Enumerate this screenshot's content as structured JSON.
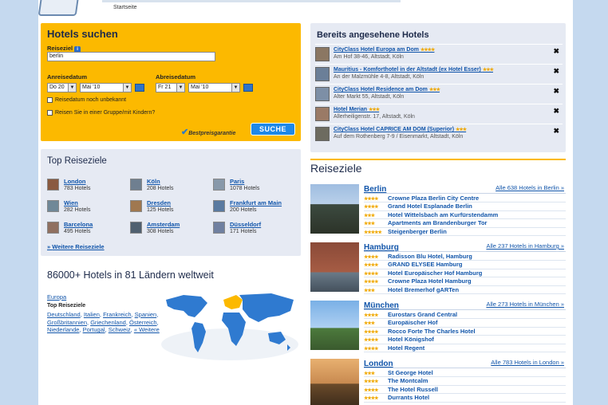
{
  "header": {
    "breadcrumb": "Startseite"
  },
  "search": {
    "title": "Hotels suchen",
    "destination_label": "Reiseziel",
    "destination_value": "berlin",
    "arrival_label": "Anreisedatum",
    "departure_label": "Abreisedatum",
    "arrival_day": "Do 20",
    "arrival_month": "Mai '10",
    "departure_day": "Fr 21",
    "departure_month": "Mai '10",
    "unknown_date_label": "Reisedatum noch unbekannt",
    "group_label": "Reisen Sie in einer Gruppe/mit Kindern?",
    "best_price": "Bestpreisgarantie",
    "button": "SUCHE"
  },
  "viewed": {
    "title": "Bereits angesehene Hotels",
    "items": [
      {
        "name": "CityClass Hotel Europa am Dom",
        "stars": "★★★★",
        "address": "Am Hof 38-46, Altstadt, Köln"
      },
      {
        "name": "Mauritius - Komforthotel in der Altstadt (ex Hotel Esser)",
        "stars": "★★★",
        "address": "An der Malzmühle 4-8, Altstadt, Köln"
      },
      {
        "name": "CityClass Hotel Residence am Dom",
        "stars": "★★★",
        "address": "Alter Markt 55, Altstadt, Köln"
      },
      {
        "name": "Hotel Merian",
        "stars": "★★★",
        "address": "Allerheiligenstr. 17, Altstadt, Köln"
      },
      {
        "name": "CityClass Hotel CAPRICE AM DOM (Superior)",
        "stars": "★★★",
        "address": "Auf dem Rothenberg 7-9 / Eisenmarkt, Altstadt, Köln"
      }
    ]
  },
  "top": {
    "title": "Top Reiseziele",
    "destinations": [
      {
        "name": "London",
        "count": "783 Hotels"
      },
      {
        "name": "Köln",
        "count": "208 Hotels"
      },
      {
        "name": "Paris",
        "count": "1078 Hotels"
      },
      {
        "name": "Wien",
        "count": "282 Hotels"
      },
      {
        "name": "Dresden",
        "count": "125 Hotels"
      },
      {
        "name": "Frankfurt am Main",
        "count": "200 Hotels"
      },
      {
        "name": "Barcelona",
        "count": "495 Hotels"
      },
      {
        "name": "Amsterdam",
        "count": "308 Hotels"
      },
      {
        "name": "Düsseldorf",
        "count": "171 Hotels"
      }
    ],
    "more": "Weitere Reiseziele"
  },
  "world": {
    "title": "86000+ Hotels in 81 Ländern weltweit",
    "region": "Europa",
    "top_label": "Top Reiseziele",
    "countries": [
      "Deutschland",
      "Italien",
      "Frankreich",
      "Spanien",
      "Großbritannien",
      "Griechenland",
      "Österreich",
      "Niederlande",
      "Portugal",
      "Schweiz"
    ],
    "more": "« Weitere"
  },
  "reiseziele": {
    "title": "Reiseziele",
    "cities": [
      {
        "name": "Berlin",
        "all": "Alle 638 Hotels in Berlin »",
        "hotels": [
          {
            "stars": "★★★★",
            "name": "Crowne Plaza Berlin City Centre"
          },
          {
            "stars": "★★★★",
            "name": "Grand Hotel Esplanade Berlin"
          },
          {
            "stars": "★★★",
            "name": "Hotel Wittelsbach am Kurfürstendamm"
          },
          {
            "stars": "★★★",
            "name": "Apartments am Brandenburger Tor"
          },
          {
            "stars": "★★★★★",
            "name": "Steigenberger Berlin"
          }
        ]
      },
      {
        "name": "Hamburg",
        "all": "Alle 237 Hotels in Hamburg »",
        "hotels": [
          {
            "stars": "★★★★",
            "name": "Radisson Blu Hotel, Hamburg"
          },
          {
            "stars": "★★★★",
            "name": "GRAND ELYSEE Hamburg"
          },
          {
            "stars": "★★★★",
            "name": "Hotel Europäischer Hof Hamburg"
          },
          {
            "stars": "★★★★",
            "name": "Crowne Plaza Hotel Hamburg"
          },
          {
            "stars": "★★★",
            "name": "Hotel Bremerhof gARTen"
          }
        ]
      },
      {
        "name": "München",
        "all": "Alle 273 Hotels in München »",
        "hotels": [
          {
            "stars": "★★★★",
            "name": "Eurostars Grand Central"
          },
          {
            "stars": "★★★",
            "name": "Europäischer Hof"
          },
          {
            "stars": "★★★★",
            "name": "Rocco Forte The Charles Hotel"
          },
          {
            "stars": "★★★★",
            "name": "Hotel Königshof"
          },
          {
            "stars": "★★★★",
            "name": "Hotel Regent"
          }
        ]
      },
      {
        "name": "London",
        "all": "Alle 783 Hotels in London »",
        "hotels": [
          {
            "stars": "★★★",
            "name": "St George Hotel"
          },
          {
            "stars": "★★★★",
            "name": "The Montcalm"
          },
          {
            "stars": "★★★★",
            "name": "The Hotel Russell"
          },
          {
            "stars": "★★★★",
            "name": "Durrants Hotel"
          }
        ]
      }
    ]
  },
  "colors": {
    "accent": "#fcb900",
    "link": "#1155aa",
    "panel": "#e6eaf3",
    "button": "#1e88e8",
    "background": "#c5d9ef"
  }
}
